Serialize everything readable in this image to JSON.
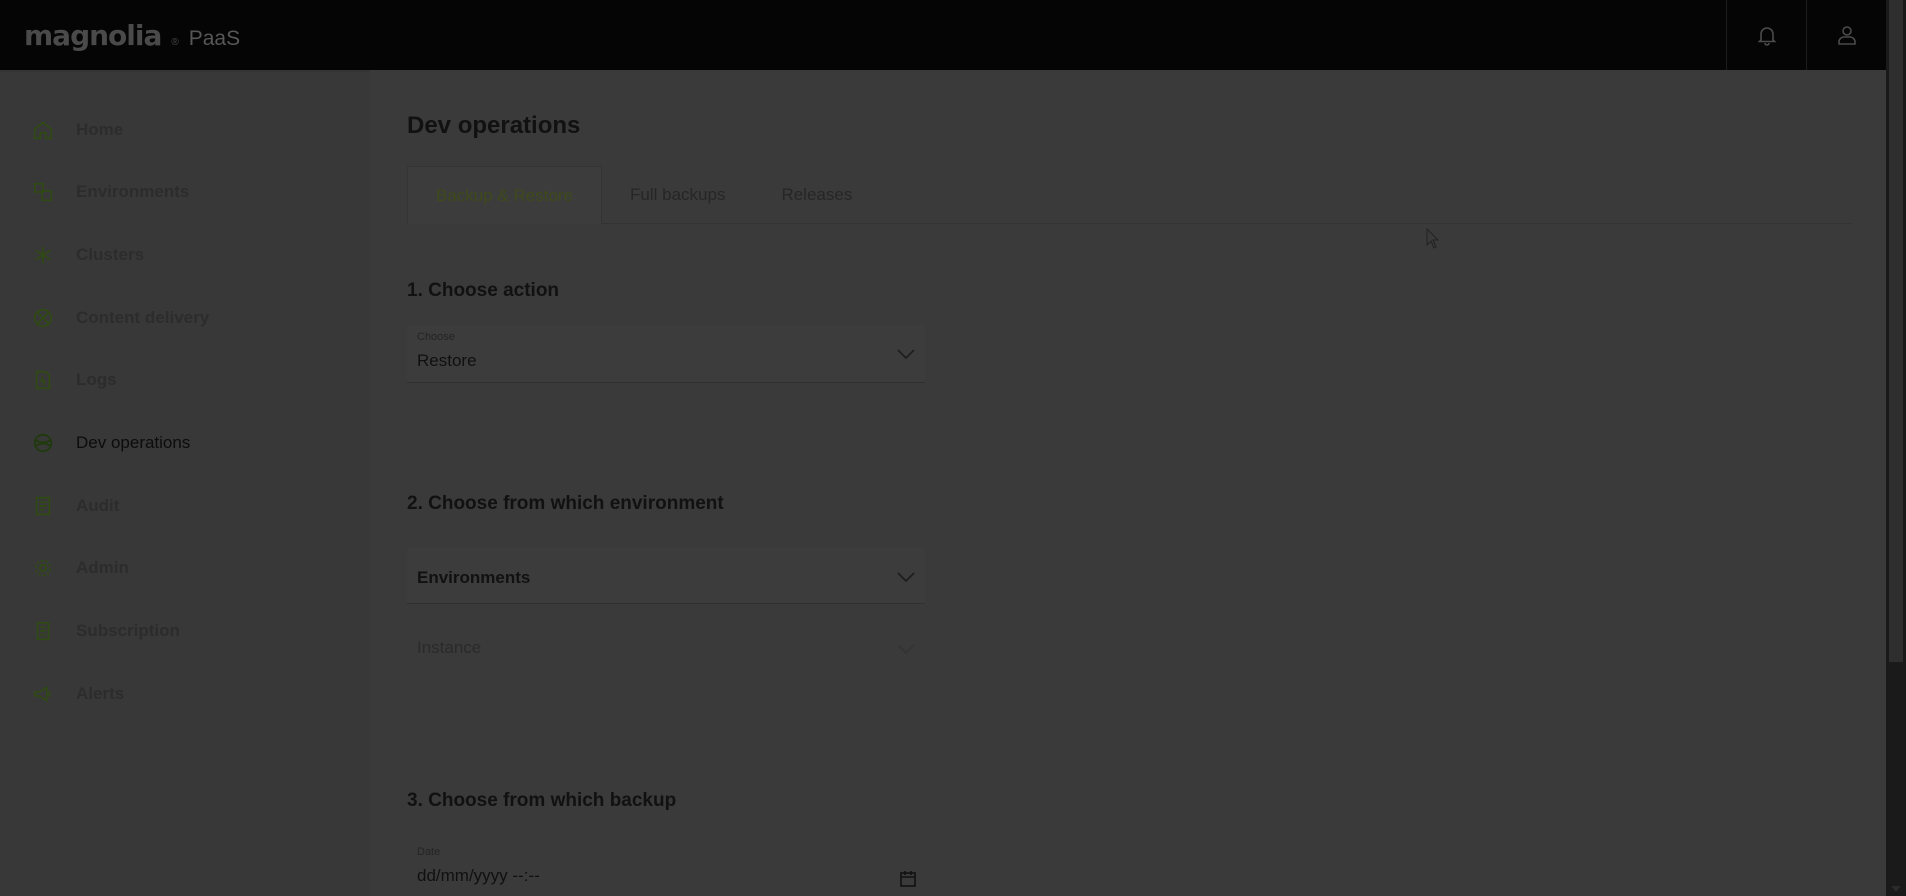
{
  "app": {
    "logo_text": "magnolia",
    "logo_mark": "®",
    "product": "PaaS"
  },
  "header": {
    "notifications_icon": "bell-icon",
    "user_icon": "user-icon"
  },
  "sidebar": {
    "items": [
      {
        "label": "Home",
        "icon": "home-icon"
      },
      {
        "label": "Environments",
        "icon": "environments-icon"
      },
      {
        "label": "Clusters",
        "icon": "clusters-icon"
      },
      {
        "label": "Content delivery",
        "icon": "content-delivery-icon"
      },
      {
        "label": "Logs",
        "icon": "logs-icon"
      },
      {
        "label": "Dev operations",
        "icon": "dev-operations-icon",
        "active": true
      },
      {
        "label": "Audit",
        "icon": "audit-icon"
      },
      {
        "label": "Admin",
        "icon": "gear-icon"
      },
      {
        "label": "Subscription",
        "icon": "subscription-icon"
      },
      {
        "label": "Alerts",
        "icon": "megaphone-icon"
      }
    ]
  },
  "main": {
    "title": "Dev operations",
    "tabs": [
      {
        "label": "Backup & Restore",
        "active": true
      },
      {
        "label": "Full backups"
      },
      {
        "label": "Releases"
      }
    ],
    "section1": {
      "title": "1. Choose action",
      "select_caption": "Choose",
      "select_value": "Restore"
    },
    "section2": {
      "title": "2. Choose from which environment",
      "environments_value": "Environments",
      "instance_value": "Instance"
    },
    "section3": {
      "title": "3. Choose from which backup",
      "date_caption": "Date",
      "date_placeholder": "dd/mm/yyyy --:--"
    }
  },
  "colors": {
    "accent": "#3e4a1a",
    "topbar": "#050505",
    "background": "#3a3a3a"
  }
}
